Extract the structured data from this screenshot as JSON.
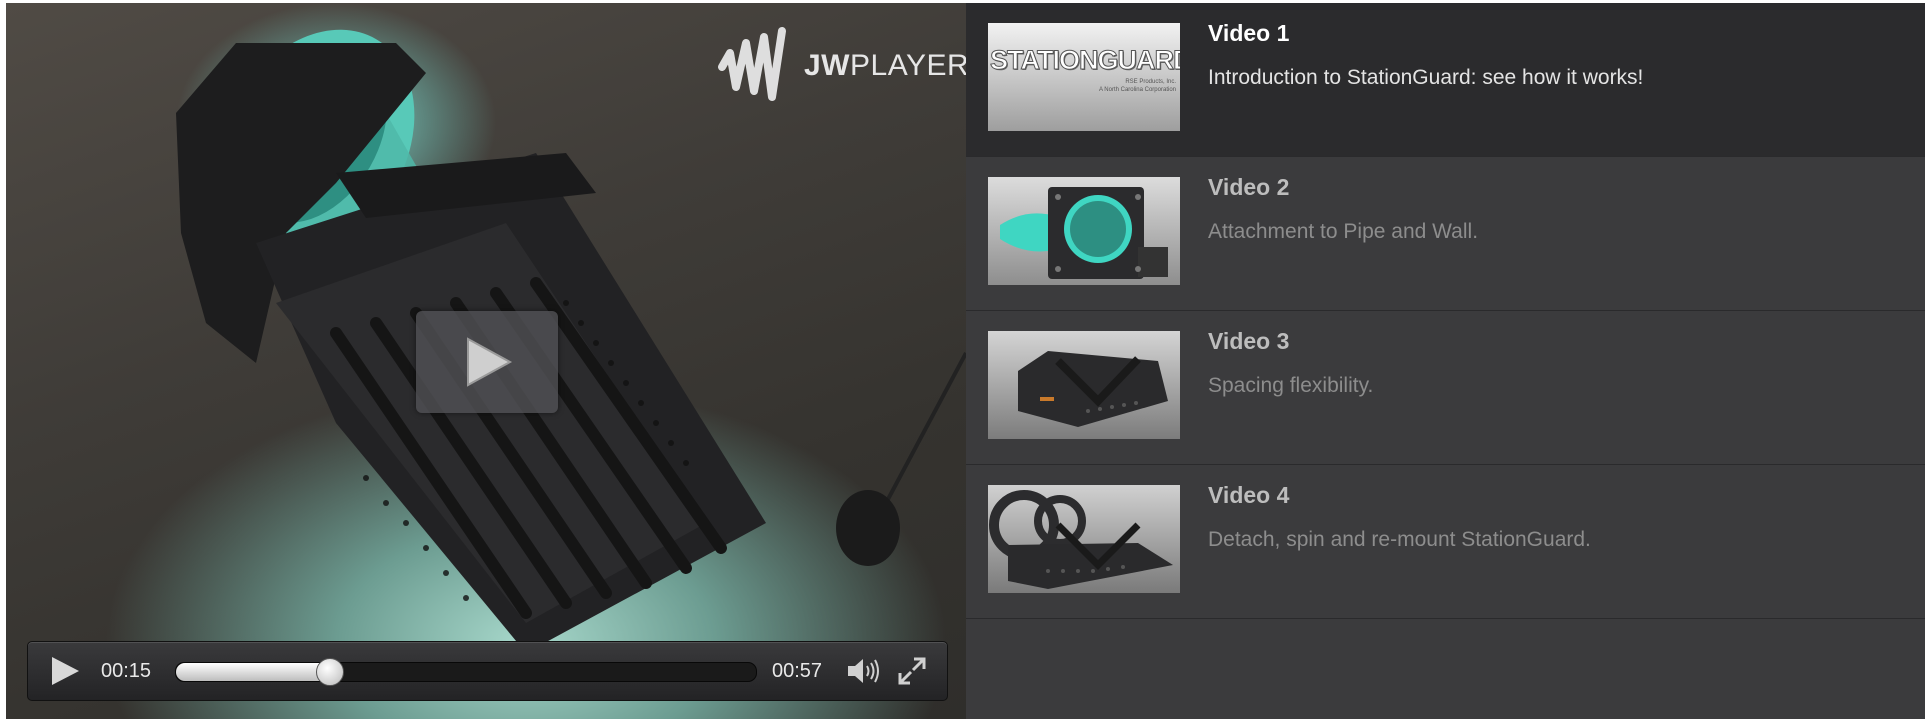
{
  "player": {
    "logo_text_bold": "JW",
    "logo_text": "PLAYER",
    "elapsed": "00:15",
    "duration": "00:57",
    "progress": 0.2632,
    "icons": {
      "big_play": "play-icon",
      "play": "play-icon",
      "volume": "volume-icon",
      "fullscreen": "fullscreen-icon"
    }
  },
  "playlist": {
    "items": [
      {
        "title": "Video 1",
        "description": "Introduction to StationGuard: see how it works!",
        "active": true,
        "thumb_text": "STATIONGUARD",
        "thumb_subtext_1": "RSE Products, Inc.",
        "thumb_subtext_2": "A North Carolina Corporation"
      },
      {
        "title": "Video 2",
        "description": "Attachment to Pipe and Wall.",
        "active": false
      },
      {
        "title": "Video 3",
        "description": "Spacing flexibility.",
        "active": false
      },
      {
        "title": "Video 4",
        "description": "Detach, spin and re-mount StationGuard.",
        "active": false
      }
    ]
  },
  "colors": {
    "accent_teal": "#3fd6c2",
    "panel_bg": "#3b3b3d",
    "active_bg": "#2b2b2d"
  }
}
